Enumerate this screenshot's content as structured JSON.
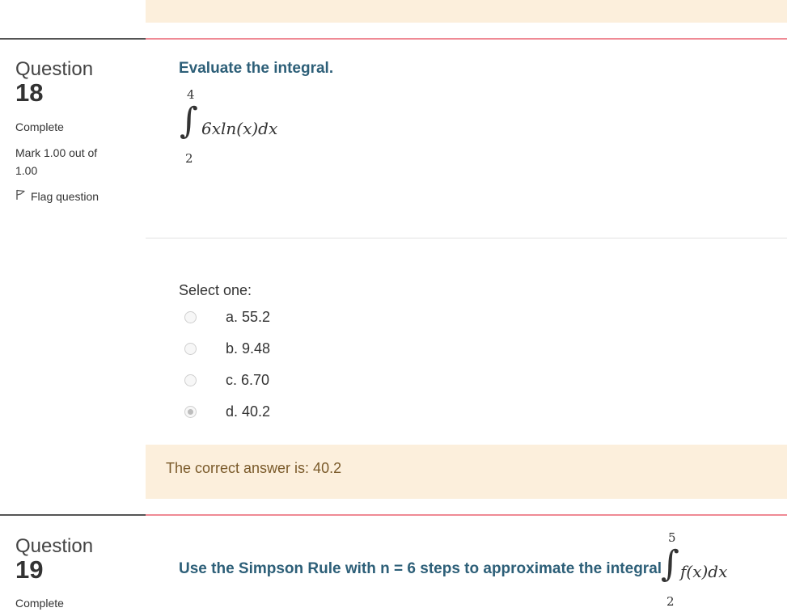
{
  "q18": {
    "word": "Question",
    "number": "18",
    "state": "Complete",
    "mark": "Mark 1.00 out of 1.00",
    "mark_line1": "Mark 1.00 out of",
    "mark_line2": "1.00",
    "flag_label": "Flag question",
    "text": "Evaluate the integral.",
    "integral": {
      "upper": "4",
      "lower": "2",
      "integrand": "6xln(x)dx"
    },
    "select_one": "Select one:",
    "options": [
      {
        "label": "a. 55.2",
        "selected": false
      },
      {
        "label": "b. 9.48",
        "selected": false
      },
      {
        "label": "c. 6.70",
        "selected": false
      },
      {
        "label": "d. 40.2",
        "selected": true
      }
    ],
    "feedback": "The correct answer is: 40.2"
  },
  "q19": {
    "word": "Question",
    "number": "19",
    "state": "Complete",
    "text": "Use the Simpson Rule with n = 6 steps to approximate the integral",
    "integral": {
      "upper": "5",
      "lower": "2",
      "integrand": "f(x)dx"
    }
  },
  "colors": {
    "question_text": "#2d5f78",
    "feedback_bg": "#fcefdc",
    "feedback_text": "#7a5a2a",
    "rule_pink": "#ef8a95"
  }
}
